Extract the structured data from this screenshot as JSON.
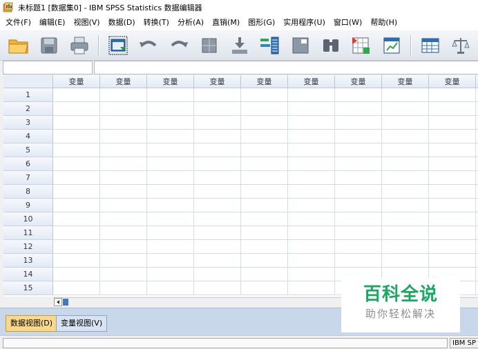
{
  "window": {
    "title": "未标题1 [数据集0] - IBM SPSS Statistics 数据编辑器"
  },
  "menu": [
    "文件(F)",
    "编辑(E)",
    "视图(V)",
    "数据(D)",
    "转换(T)",
    "分析(A)",
    "直销(M)",
    "图形(G)",
    "实用程序(U)",
    "窗口(W)",
    "帮助(H)"
  ],
  "toolbar": [
    {
      "icon": "open-folder-icon"
    },
    {
      "icon": "save-icon"
    },
    {
      "icon": "print-icon"
    },
    {
      "icon": "dialog-recall-icon"
    },
    {
      "icon": "undo-icon"
    },
    {
      "icon": "redo-icon"
    },
    {
      "icon": "goto-case-icon"
    },
    {
      "icon": "goto-variable-icon"
    },
    {
      "icon": "variables-icon"
    },
    {
      "icon": "run-descriptives-icon"
    },
    {
      "icon": "find-icon"
    },
    {
      "icon": "insert-cases-icon"
    },
    {
      "icon": "insert-variable-icon"
    },
    {
      "icon": "split-file-icon"
    },
    {
      "icon": "weight-cases-icon"
    },
    {
      "icon": "select-cases-icon"
    },
    {
      "icon": "value-labels-icon"
    }
  ],
  "grid": {
    "column_header": "变量",
    "column_count": 9,
    "rows": [
      "1",
      "2",
      "3",
      "4",
      "5",
      "6",
      "7",
      "8",
      "9",
      "10",
      "11",
      "12",
      "13",
      "14",
      "15"
    ]
  },
  "tabs": {
    "data_view": "数据视图(D)",
    "variable_view": "变量视图(V)"
  },
  "status": {
    "right": "IBM SP"
  },
  "watermark": {
    "title": "百科全说",
    "subtitle": "助你轻松解决"
  },
  "colors": {
    "active_tab": "#f8d98c",
    "watermark_green": "#17a862"
  }
}
